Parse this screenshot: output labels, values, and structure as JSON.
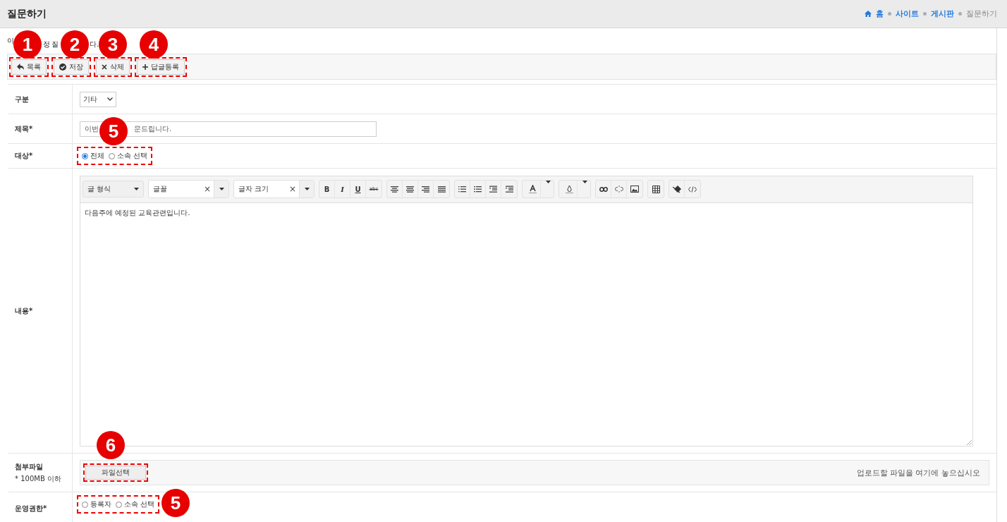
{
  "header": {
    "title": "질문하기",
    "breadcrumbs": [
      {
        "label": "홈",
        "current": false,
        "kind": "home"
      },
      {
        "label": "사이트",
        "current": false,
        "kind": "link"
      },
      {
        "label": "게시판",
        "current": false,
        "kind": "link"
      },
      {
        "label": "질문하기",
        "current": true,
        "kind": "link"
      }
    ]
  },
  "subtitle_fragments": [
    "이",
    "정 질",
    "다."
  ],
  "toolbar": [
    {
      "label": "목록",
      "kind": "back",
      "highlighted": true
    },
    {
      "label": "저장",
      "kind": "save",
      "highlighted": true
    },
    {
      "label": "삭제",
      "kind": "delete",
      "highlighted": true
    },
    {
      "label": "답글등록",
      "kind": "add",
      "highlighted": true
    }
  ],
  "form": {
    "category": {
      "label": "구분",
      "value": "기타"
    },
    "subject": {
      "label": "제목*",
      "value_fragments": [
        "이번",
        "문드립니다."
      ]
    },
    "target": {
      "label": "대상*",
      "highlighted": true,
      "options": [
        {
          "label": "전체",
          "selected": true
        },
        {
          "label": "소속 선택",
          "selected": false
        }
      ]
    },
    "content": {
      "label": "내용*",
      "dropdowns": [
        {
          "label": "글 형식",
          "kind": "plain"
        },
        {
          "label": "글꼴",
          "kind": "clearable",
          "clear": "×"
        },
        {
          "label": "글자 크기",
          "kind": "clearable",
          "clear": "×"
        }
      ],
      "format_buttons": [
        "B",
        "I",
        "U",
        "abc"
      ],
      "text": "다음주에 예정된 교육관련입니다."
    },
    "attachment": {
      "label": "첨부파일",
      "note": "* 100MB 이하",
      "button": "파일선택",
      "button_highlighted": true,
      "drop_hint": "업로드할 파일을 여기에 놓으십시오"
    },
    "permission": {
      "label": "운영권한*",
      "highlighted": true,
      "options": [
        {
          "label": "등록자",
          "selected": false
        },
        {
          "label": "소속 선택",
          "selected": false
        }
      ]
    }
  },
  "callouts": [
    {
      "number": "1"
    },
    {
      "number": "2"
    },
    {
      "number": "3"
    },
    {
      "number": "4"
    },
    {
      "number": "5"
    },
    {
      "number": "6"
    },
    {
      "number": "5"
    }
  ]
}
